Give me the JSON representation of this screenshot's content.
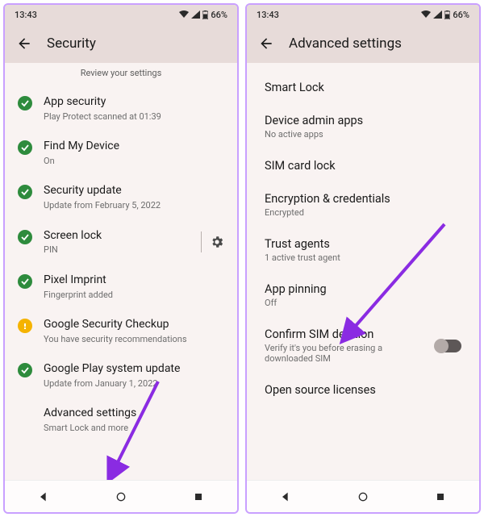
{
  "status": {
    "time": "13:43",
    "battery": "66%"
  },
  "left": {
    "title": "Security",
    "review": "Review your settings",
    "items": [
      {
        "label": "App security",
        "sub": "Play Protect scanned at 01:39",
        "badge": "green"
      },
      {
        "label": "Find My Device",
        "sub": "On",
        "badge": "green"
      },
      {
        "label": "Security update",
        "sub": "Update from February 5, 2022",
        "badge": "green"
      },
      {
        "label": "Screen lock",
        "sub": "PIN",
        "badge": "green",
        "gear": true
      },
      {
        "label": "Pixel Imprint",
        "sub": "Fingerprint added",
        "badge": "green"
      },
      {
        "label": "Google Security Checkup",
        "sub": "You have security recommendations",
        "badge": "orange"
      },
      {
        "label": "Google Play system update",
        "sub": "Update from January 1, 2022",
        "badge": "green"
      },
      {
        "label": "Advanced settings",
        "sub": "Smart Lock and more",
        "badge": ""
      }
    ]
  },
  "right": {
    "title": "Advanced settings",
    "items": [
      {
        "label": "Smart Lock",
        "sub": ""
      },
      {
        "label": "Device admin apps",
        "sub": "No active apps"
      },
      {
        "label": "SIM card lock",
        "sub": ""
      },
      {
        "label": "Encryption & credentials",
        "sub": "Encrypted"
      },
      {
        "label": "Trust agents",
        "sub": "1 active trust agent"
      },
      {
        "label": "App pinning",
        "sub": "Off"
      },
      {
        "label": "Confirm SIM deletion",
        "sub": "Verify it's you before erasing a downloaded SIM",
        "toggle": true
      },
      {
        "label": "Open source licenses",
        "sub": ""
      }
    ]
  }
}
